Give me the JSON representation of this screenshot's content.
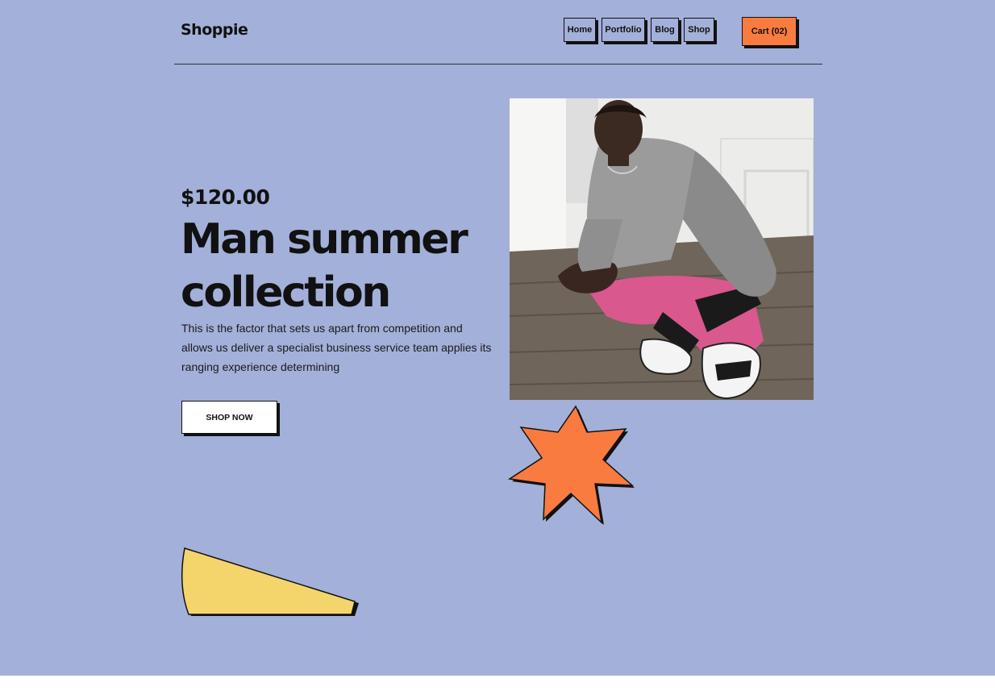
{
  "brand": {
    "name": "Shoppie"
  },
  "nav": {
    "items": [
      {
        "label": "Home"
      },
      {
        "label": "Portfolio"
      },
      {
        "label": "Blog"
      },
      {
        "label": "Shop"
      }
    ],
    "cart_label": "Cart (02)"
  },
  "hero": {
    "price": "$120.00",
    "title_line1": "Man summer",
    "title_line2": "collection",
    "description": "This is the factor that sets us apart from competition and allows us deliver a specialist business service team applies its ranging experience determining",
    "cta_label": "SHOP NOW"
  },
  "colors": {
    "background": "#a3b0d9",
    "accent_orange": "#fa7b40",
    "accent_yellow": "#f3d56b",
    "ink": "#111111"
  },
  "icons": {
    "decor_star": "orange-star-shape",
    "decor_wedge": "yellow-wedge-shape"
  }
}
